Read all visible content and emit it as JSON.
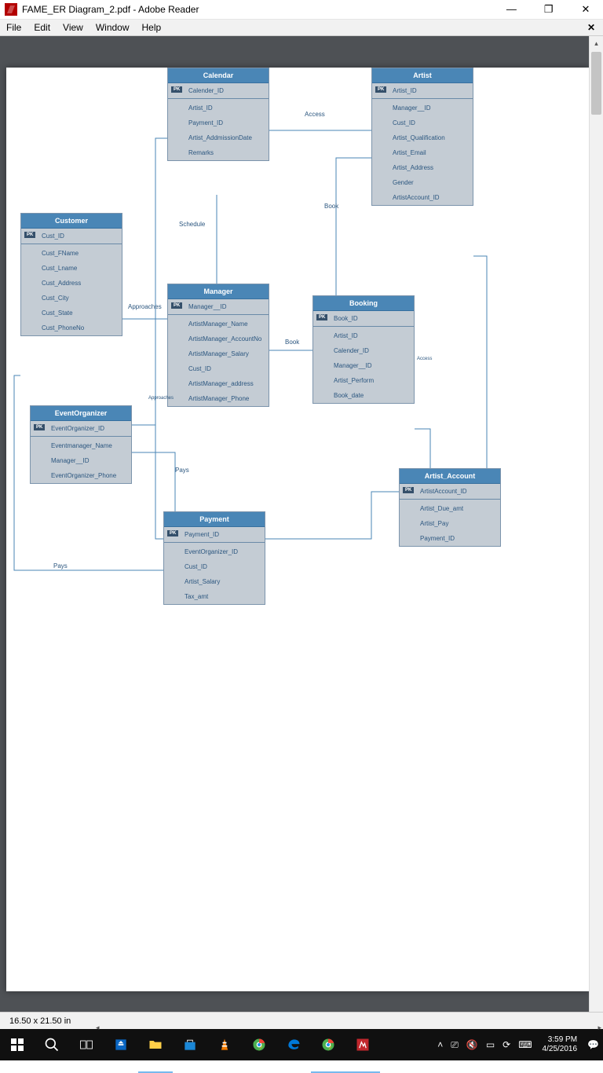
{
  "window": {
    "title": "FAME_ER Diagram_2.pdf - Adobe Reader",
    "menu": [
      "File",
      "Edit",
      "View",
      "Window",
      "Help"
    ],
    "dims": "16.50 x 21.50 in"
  },
  "entities": {
    "calendar": {
      "title": "Calendar",
      "pk": "Calender_ID",
      "attrs": [
        "Artist_ID",
        "Payment_ID",
        "Artist_AddmissionDate",
        "Remarks"
      ]
    },
    "artist": {
      "title": "Artist",
      "pk": "Artist_ID",
      "attrs": [
        "Manager__ID",
        "Cust_ID",
        "Artist_Qualification",
        "Artist_Email",
        "Artist_Address",
        "Gender",
        "ArtistAccount_ID"
      ]
    },
    "customer": {
      "title": "Customer",
      "pk": "Cust_ID",
      "attrs": [
        "Cust_FName",
        "Cust_Lname",
        "Cust_Address",
        "Cust_City",
        "Cust_State",
        "Cust_PhoneNo"
      ]
    },
    "manager": {
      "title": "Manager",
      "pk": "Manager__ID",
      "attrs": [
        "ArtistManager_Name",
        "ArtistManager_AccountNo",
        "ArtistManager_Salary",
        "Cust_ID",
        "ArtistManager_address",
        "ArtistManager_Phone"
      ]
    },
    "booking": {
      "title": "Booking",
      "pk": "Book_ID",
      "attrs": [
        "Artist_ID",
        "Calender_ID",
        "Manager__ID",
        "Artist_Perform",
        "Book_date"
      ]
    },
    "eventorg": {
      "title": "EventOrganizer",
      "pk": "EventOrganizer_ID",
      "attrs": [
        "Eventmanager_Name",
        "Manager__ID",
        "EventOrganizer_Phone"
      ]
    },
    "artacct": {
      "title": "Artist_Account",
      "pk": "ArtistAccount_ID",
      "attrs": [
        "Artist_Due_amt",
        "Artist_Pay",
        "Payment_ID"
      ]
    },
    "payment": {
      "title": "Payment",
      "pk": "Payment_ID",
      "attrs": [
        "EventOrganizer_ID",
        "Cust_ID",
        "Artist_Salary",
        "Tax_amt"
      ]
    }
  },
  "rels": {
    "access": "Access",
    "schedule": "Schedule",
    "approaches": "Approaches",
    "approaches2": "Approaches",
    "book": "Book",
    "book2": "Book",
    "pays": "Pays",
    "pays2": "Pays",
    "access2": "Access"
  },
  "clock": {
    "time": "3:59 PM",
    "date": "4/25/2016"
  }
}
